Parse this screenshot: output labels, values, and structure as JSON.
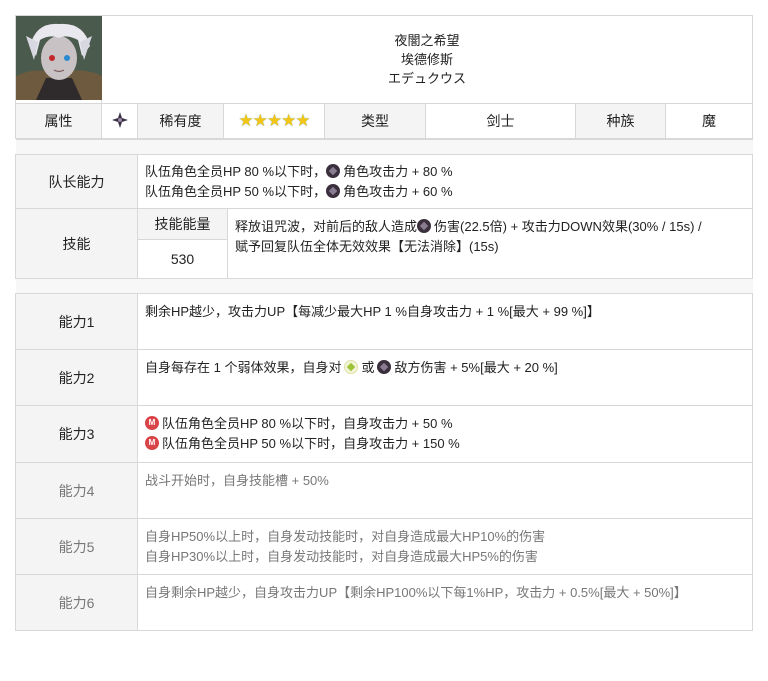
{
  "character": {
    "name_title": "夜闇之希望",
    "name_cn": "埃德修斯",
    "name_jp": "エデュクウス"
  },
  "info_row": {
    "attribute_label": "属性",
    "attribute_icon": "dark-element-icon",
    "rarity_label": "稀有度",
    "rarity_stars": "★★★★★",
    "type_label": "类型",
    "type_value": "剑士",
    "race_label": "种族",
    "race_value": "魔"
  },
  "leader": {
    "label": "队长能力",
    "lines": [
      {
        "pre": "队伍角色全员HP 80 %以下时，",
        "icon": "dark-element-icon",
        "post": "角色攻击力 + 80 %"
      },
      {
        "pre": "队伍角色全员HP 50 %以下时，",
        "icon": "dark-element-icon",
        "post": "角色攻击力 + 60 %"
      }
    ]
  },
  "skill": {
    "label": "技能",
    "energy_label": "技能能量",
    "energy_value": "530",
    "desc_pre": "释放诅咒波，对前后的敌人造成",
    "desc_post": "伤害(22.5倍) + 攻击力DOWN效果(30% / 15s) /",
    "desc_line2": "赋予回复队伍全体无效效果【无法消除】(15s)"
  },
  "abilities": [
    {
      "label": "能力1",
      "lines": [
        "剩余HP越少，攻击力UP【每减少最大HP 1 %自身攻击力 + 1 %[最大 + 99 %]】"
      ]
    },
    {
      "label": "能力2",
      "pre": "自身每存在 1 个弱体效果，自身对",
      "mid": "或",
      "post": "敌方伤害 + 5%[最大 + 20 %]"
    },
    {
      "label": "能力3",
      "lines": [
        "队伍角色全员HP 80 %以下时，自身攻击力 + 50 %",
        "队伍角色全员HP 50 %以下时，自身攻击力 + 150 %"
      ]
    },
    {
      "label": "能力4",
      "lines": [
        "战斗开始时，自身技能槽 + 50%"
      ]
    },
    {
      "label": "能力5",
      "lines": [
        "自身HP50%以上时，自身发动技能时，对自身造成最大HP10%的伤害",
        "自身HP30%以上时，自身发动技能时，对自身造成最大HP5%的伤害"
      ]
    },
    {
      "label": "能力6",
      "lines": [
        "自身剩余HP越少，自身攻击力UP【剩余HP100%以下每1%HP，攻击力 + 0.5%[最大 + 50%]】"
      ]
    }
  ]
}
